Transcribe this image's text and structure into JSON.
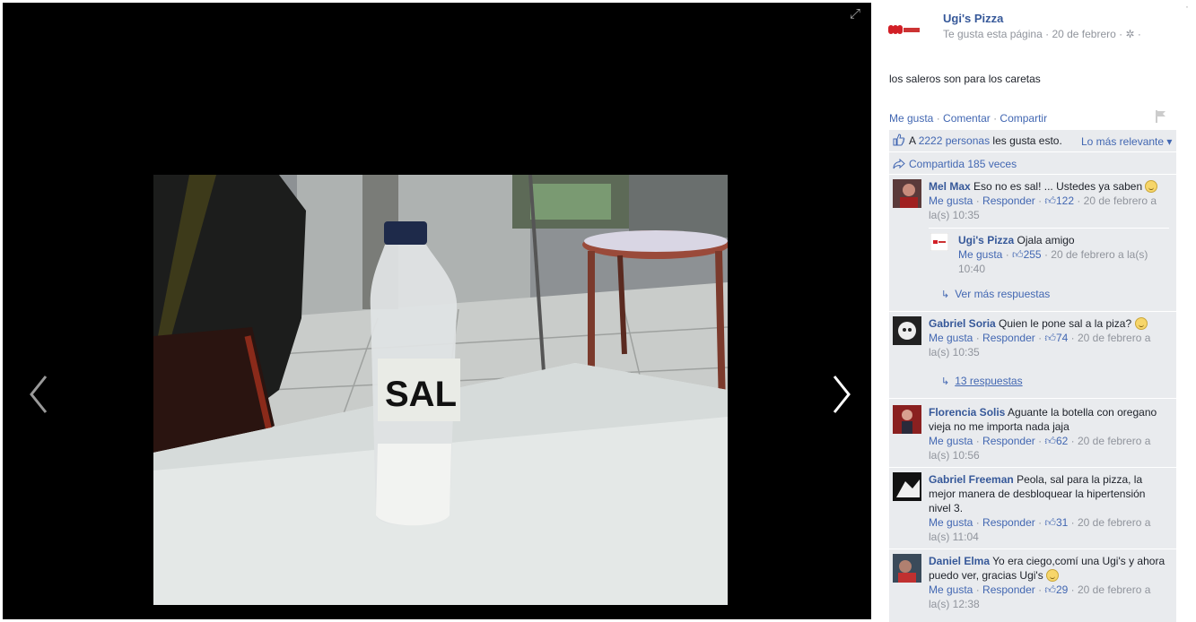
{
  "post": {
    "page_name": "Ugi's Pizza",
    "liked_text": "Te gusta esta página",
    "date": "20 de febrero",
    "text": "los saleros son para los caretas",
    "photo_label_text": "SAL"
  },
  "actions": {
    "like": "Me gusta",
    "comment": "Comentar",
    "share": "Compartir",
    "separator": "·"
  },
  "likes": {
    "prefix": "A ",
    "people": "2222 personas",
    "suffix": " les gusta esto.",
    "sort_label": "Lo más relevante ▾"
  },
  "shares": {
    "text": "Compartida 185 veces"
  },
  "comments": [
    {
      "name": "Mel Max",
      "text": "Eso no es sal! ... Ustedes ya saben",
      "like": "Me gusta",
      "reply": "Responder",
      "count": "122",
      "time": "20 de febrero a la(s) 10:35",
      "reply_item": {
        "name": "Ugi's Pizza",
        "text": "Ojala amigo",
        "like": "Me gusta",
        "count": "255",
        "time": "20 de febrero a la(s) 10:40"
      },
      "more": "Ver más respuestas"
    },
    {
      "name": "Gabriel Soria",
      "text": "Quien le pone sal a la piza?",
      "like": "Me gusta",
      "reply": "Responder",
      "count": "74",
      "time": "20 de febrero a la(s) 10:35",
      "more": "13 respuestas"
    },
    {
      "name": "Florencia Solis",
      "text": "Aguante la botella con oregano vieja no me importa nada jaja",
      "like": "Me gusta",
      "reply": "Responder",
      "count": "62",
      "time": "20 de febrero a la(s) 10:56"
    },
    {
      "name": "Gabriel Freeman",
      "text": "Peola, sal para la pizza, la mejor manera de desbloquear la hipertensión nivel 3.",
      "like": "Me gusta",
      "reply": "Responder",
      "count": "31",
      "time": "20 de febrero a la(s) 11:04"
    },
    {
      "name": "Daniel Elma",
      "text": "Yo era ciego,comí una Ugi's y ahora puedo ver, gracias Ugi's",
      "like": "Me gusta",
      "reply": "Responder",
      "count": "29",
      "time": "20 de febrero a la(s) 12:38"
    }
  ],
  "colors": {
    "link": "#4267b2",
    "name": "#365899",
    "muted": "#90949c",
    "feedback_bg": "#e9ebee",
    "viewer_bg": "#000000"
  },
  "icons": [
    "expand-icon",
    "prev-arrow-icon",
    "next-arrow-icon",
    "gear-icon",
    "flag-icon",
    "thumbs-up-icon",
    "share-icon",
    "reply-arrow-icon",
    "smile-emoji-icon",
    "close-icon"
  ]
}
